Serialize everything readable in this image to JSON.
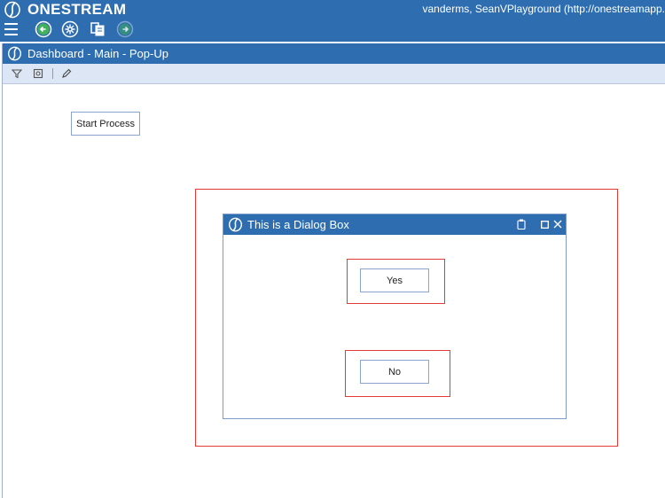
{
  "app": {
    "brand": "ONESTREAM",
    "user_info": "vanderms, SeanVPlayground (http://onestreamapp."
  },
  "toolbar": {
    "icons": [
      "menu-icon",
      "back-icon",
      "workflow-icon",
      "copy-icon",
      "forward-icon"
    ]
  },
  "panel": {
    "title": "Dashboard - Main - Pop-Up",
    "toolbar_icons": [
      "filter-icon",
      "settings-icon",
      "edit-icon"
    ]
  },
  "dashboard": {
    "start_button": "Start Process"
  },
  "dialog": {
    "title": "This is a Dialog Box",
    "yes_button": "Yes",
    "no_button": "No"
  },
  "colors": {
    "header": "#2e6eb0",
    "panel_toolbar": "#dde6f4",
    "highlight": "#e53935",
    "button_border": "#8aa5cc"
  }
}
